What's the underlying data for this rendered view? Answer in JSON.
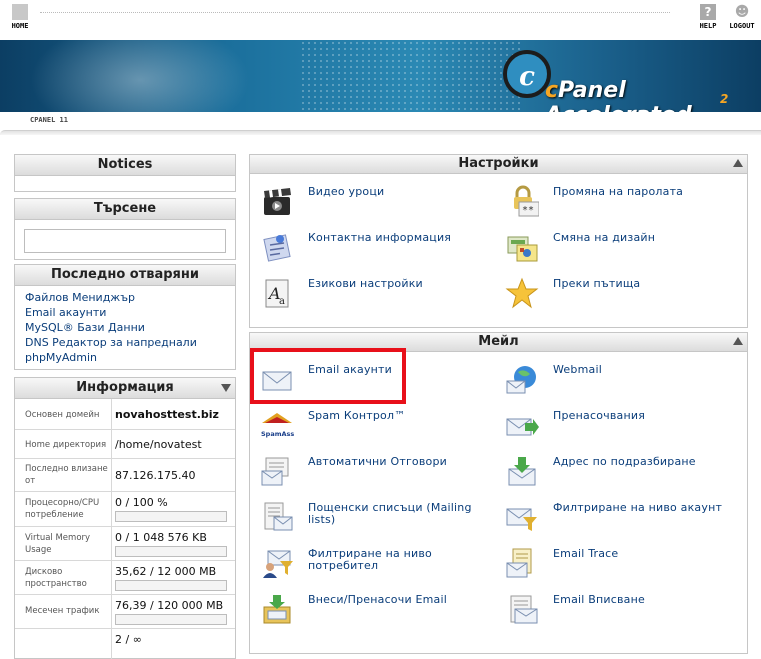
{
  "topbar": {
    "home_label": "HOME",
    "help_label": "HELP",
    "logout_label": "LOGOUT"
  },
  "banner": {
    "logo_text_c": "c",
    "logo_text_panel": "Panel",
    "logo_text_accel": "Accelerated",
    "logo_sub": "2"
  },
  "subbar": {
    "tab_label": "CPANEL 11"
  },
  "notices": {
    "title": "Notices"
  },
  "search": {
    "title": "Търсене",
    "value": ""
  },
  "recent": {
    "title": "Последно отваряни",
    "items": [
      "Файлов Мениджър",
      "Email акаунти",
      "MySQL® Бази Данни",
      "DNS Редактор за напреднали",
      "phpMyAdmin"
    ]
  },
  "info": {
    "title": "Информация",
    "rows": [
      {
        "label": "Основен домейн",
        "value": "novahosttest.biz"
      },
      {
        "label": "Home директория",
        "value": "/home/novatest"
      },
      {
        "label": "Последно влизане от",
        "value": "87.126.175.40"
      },
      {
        "label": "Процесорно/CPU потребление",
        "value": "0 / 100 %",
        "fill": 0.0
      },
      {
        "label": "Virtual Memory Usage",
        "value": "0 / 1 048 576 KB",
        "fill": 0.0
      },
      {
        "label": "Дисково пространство",
        "value": "35,62 / 12 000 MB",
        "fill": 0.003
      },
      {
        "label": "Месечен трафик",
        "value": "76,39 / 120 000 MB",
        "fill": 0.001
      },
      {
        "label": "",
        "value": "2 / ∞"
      }
    ]
  },
  "settings": {
    "title": "Настройки",
    "items": [
      {
        "label": "Видео уроци",
        "icon": "video-clapper-icon"
      },
      {
        "label": "Промяна на паролата",
        "icon": "password-lock-icon"
      },
      {
        "label": "Контактна информация",
        "icon": "contact-info-icon"
      },
      {
        "label": "Смяна на дизайн",
        "icon": "design-theme-icon"
      },
      {
        "label": "Езикови настройки",
        "icon": "language-icon"
      },
      {
        "label": "Преки пътища",
        "icon": "star-shortcut-icon"
      }
    ]
  },
  "mail": {
    "title": "Мейл",
    "items": [
      {
        "label": "Email акаунти",
        "icon": "envelope-icon"
      },
      {
        "label": "Webmail",
        "icon": "webmail-globe-icon"
      },
      {
        "label": "Spam Контрол™",
        "icon": "spamassassin-icon",
        "icon_text": "SpamAssassin"
      },
      {
        "label": "Пренасочвания",
        "icon": "forward-envelope-icon"
      },
      {
        "label": "Автоматични Отговори",
        "icon": "autoresponder-icon"
      },
      {
        "label": "Адрес по подразбиране",
        "icon": "default-address-icon"
      },
      {
        "label": "Пощенски списъци (Mailing lists)",
        "icon": "mailing-list-icon"
      },
      {
        "label": "Филтриране на ниво акаунт",
        "icon": "account-filter-icon"
      },
      {
        "label": "Филтриране на ниво потребител",
        "icon": "user-filter-icon"
      },
      {
        "label": "Email Trace",
        "icon": "email-trace-icon"
      },
      {
        "label": "Внеси/Пренасочи Email",
        "icon": "import-email-icon"
      },
      {
        "label": "Email Вписване",
        "icon": "email-auth-icon"
      }
    ]
  },
  "colors": {
    "link": "#0a3d7a",
    "highlight": "#e8101a",
    "banner": "#1b6f9c"
  }
}
